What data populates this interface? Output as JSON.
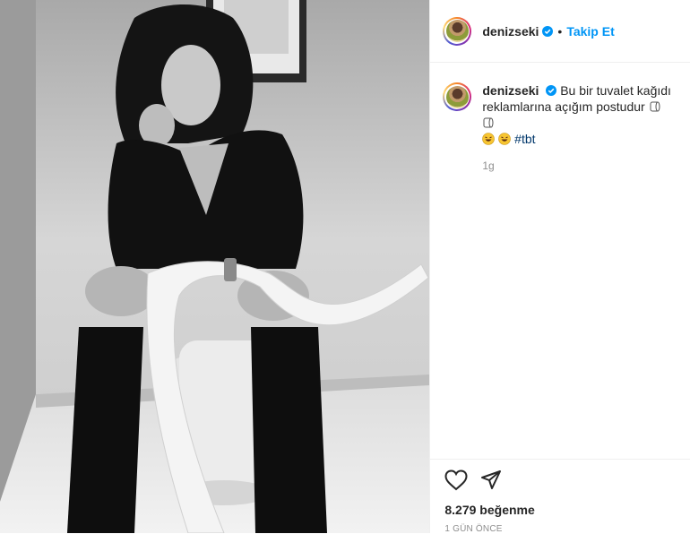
{
  "post": {
    "username": "denizseki",
    "follow_label": "Takip Et",
    "separator": "•",
    "caption_text": "Bu bir tuvalet kağıdı reklamlarına açığım postudur",
    "hashtag": "#tbt",
    "caption_time": "1g",
    "likes": "8.279 beğenme",
    "posted_ago": "1 GÜN ÖNCE",
    "media_description_icon": "photo"
  },
  "colors": {
    "accent": "#0095f6",
    "hashtag": "#00376b",
    "muted": "#8e8e8e",
    "text": "#262626"
  },
  "icons": {
    "verified": "verified-badge-icon",
    "like": "heart-icon",
    "share": "paper-plane-icon"
  }
}
